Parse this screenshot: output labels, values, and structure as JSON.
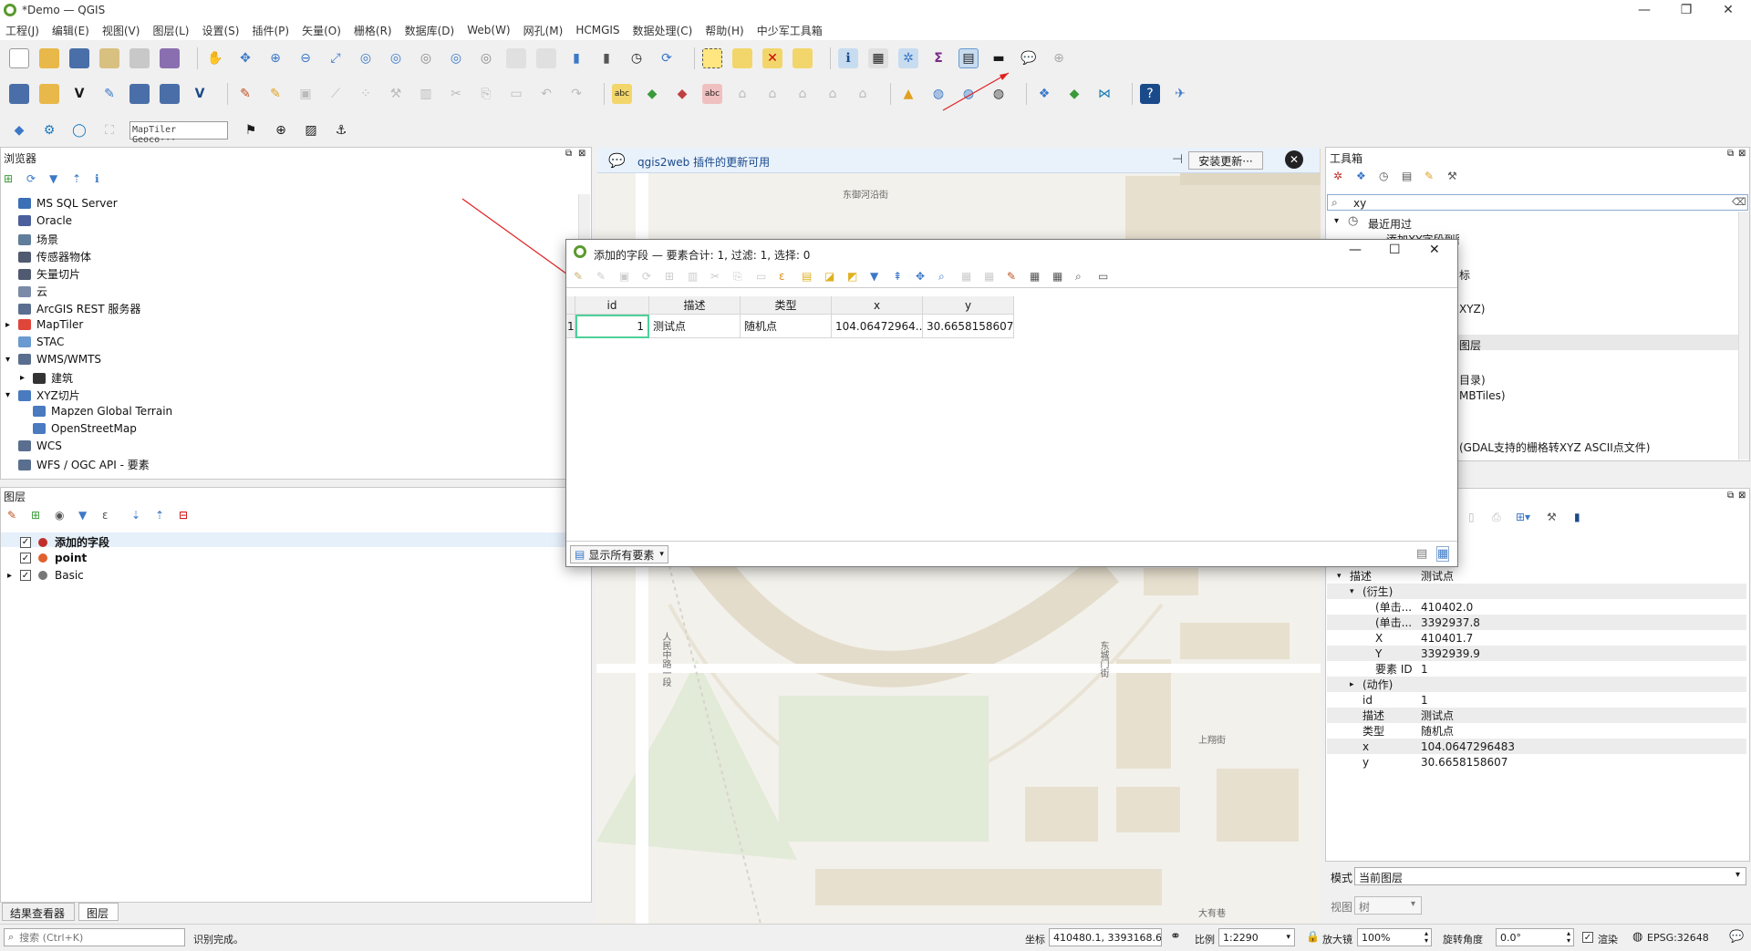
{
  "window": {
    "title": "*Demo — QGIS",
    "min": "—",
    "max": "❐",
    "close": "✕"
  },
  "menu": [
    "工程(J)",
    "编辑(E)",
    "视图(V)",
    "图层(L)",
    "设置(S)",
    "插件(P)",
    "矢量(O)",
    "栅格(R)",
    "数据库(D)",
    "Web(W)",
    "网孔(M)",
    "HCMGIS",
    "数据处理(C)",
    "帮助(H)",
    "中少军工具箱"
  ],
  "toolbar3": {
    "geocoder_placeholder": "MapTiler Geoco···"
  },
  "browser": {
    "title": "浏览器",
    "items": [
      {
        "label": "MS SQL Server",
        "icon": "mssql-icon",
        "color": "#3b6fb6"
      },
      {
        "label": "Oracle",
        "icon": "oracle-icon",
        "color": "#4a5f9c"
      },
      {
        "label": "场景",
        "icon": "scene-icon",
        "color": "#607d9b"
      },
      {
        "label": "传感器物体",
        "icon": "sensor-icon",
        "color": "#505a70"
      },
      {
        "label": "矢量切片",
        "icon": "vector-tiles-icon",
        "color": "#505a70"
      },
      {
        "label": "云",
        "icon": "cloud-icon",
        "color": "#7a8aa8"
      },
      {
        "label": "ArcGIS REST 服务器",
        "icon": "arcgis-icon",
        "color": "#5a6f8f"
      },
      {
        "label": "MapTiler",
        "icon": "maptiler-icon",
        "color": "#e0453a"
      },
      {
        "label": "STAC",
        "icon": "stac-icon",
        "color": "#6a9ad0"
      },
      {
        "label": "WMS/WMTS",
        "icon": "wms-icon",
        "color": "#5a6f8f"
      },
      {
        "label": "建筑",
        "icon": "layer-icon",
        "color": "#333"
      },
      {
        "label": "XYZ切片",
        "icon": "xyz-icon",
        "color": "#4a7ac0"
      },
      {
        "label": "Mapzen Global Terrain",
        "icon": "tile-icon",
        "color": "#4a7ac0"
      },
      {
        "label": "OpenStreetMap",
        "icon": "tile-icon",
        "color": "#4a7ac0"
      },
      {
        "label": "WCS",
        "icon": "wcs-icon",
        "color": "#5a6f8f"
      },
      {
        "label": "WFS / OGC API - 要素",
        "icon": "wfs-icon",
        "color": "#5a6f8f"
      }
    ]
  },
  "layers": {
    "title": "图层",
    "items": [
      {
        "label": "添加的字段",
        "color": "#c0302a",
        "bold": true
      },
      {
        "label": "point",
        "color": "#e06030",
        "bold": true
      },
      {
        "label": "Basic",
        "color": "#777",
        "bold": false
      }
    ]
  },
  "bottom_tabs": [
    "结果查看器",
    "图层"
  ],
  "notice": {
    "text": "qgis2web 插件的更新可用",
    "button": "安装更新···"
  },
  "map_labels": [
    "东御河沿街",
    "人民中路一段",
    "东城门街",
    "上翔街",
    "大有巷"
  ],
  "dialog": {
    "title": "添加的字段 — 要素合计: 1, 过滤: 1, 选择: 0",
    "columns": [
      "id",
      "描述",
      "类型",
      "x",
      "y"
    ],
    "row_header": "1",
    "rows": [
      [
        "1",
        "测试点",
        "随机点",
        "104.06472964...",
        "30.6658158607"
      ]
    ],
    "show_all": "显示所有要素"
  },
  "toolbox": {
    "title": "工具箱",
    "search": "xy",
    "recent": "最近用过",
    "fragments": [
      "添加XY字段到图层",
      "标",
      "XYZ)",
      "图层",
      "目录)",
      "MBTiles)",
      "(GDAL支持的栅格转XYZ ASCII点文件)"
    ]
  },
  "identify": {
    "rows": [
      {
        "k": "描述",
        "v": "测试点",
        "lvl": 0,
        "tri": "open"
      },
      {
        "k": "(衍生)",
        "v": "",
        "lvl": 1,
        "tri": "open"
      },
      {
        "k": "(单击...",
        "v": "410402.0",
        "lvl": 2,
        "tri": ""
      },
      {
        "k": "(单击...",
        "v": "3392937.8",
        "lvl": 2,
        "tri": ""
      },
      {
        "k": "X",
        "v": "410401.7",
        "lvl": 2,
        "tri": ""
      },
      {
        "k": "Y",
        "v": "3392939.9",
        "lvl": 2,
        "tri": ""
      },
      {
        "k": "要素 ID",
        "v": "1",
        "lvl": 2,
        "tri": ""
      },
      {
        "k": "(动作)",
        "v": "",
        "lvl": 1,
        "tri": "closed"
      },
      {
        "k": "id",
        "v": "1",
        "lvl": 1,
        "tri": ""
      },
      {
        "k": "描述",
        "v": "测试点",
        "lvl": 1,
        "tri": ""
      },
      {
        "k": "类型",
        "v": "随机点",
        "lvl": 1,
        "tri": ""
      },
      {
        "k": "x",
        "v": "104.0647296483",
        "lvl": 1,
        "tri": ""
      },
      {
        "k": "y",
        "v": "30.6658158607",
        "lvl": 1,
        "tri": ""
      }
    ],
    "mode_label": "模式",
    "mode_value": "当前图层",
    "view_label": "视图",
    "view_value": "树"
  },
  "status": {
    "search_placeholder": "搜索 (Ctrl+K)",
    "message": "识别完成。",
    "coord_label": "坐标",
    "coord_value": "410480.1, 3393168.6",
    "scale_label": "比例",
    "scale_value": "1:2290",
    "magnifier_label": "放大镜",
    "magnifier_value": "100%",
    "rotation_label": "旋转角度",
    "rotation_value": "0.0°",
    "render_label": "渲染",
    "crs": "EPSG:32648"
  }
}
